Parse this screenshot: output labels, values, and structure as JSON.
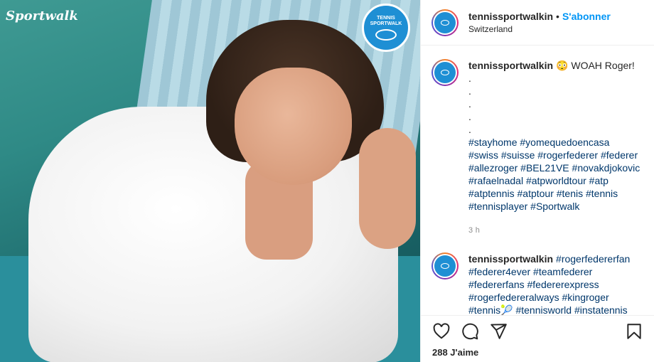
{
  "post": {
    "watermark": "Sportwalk",
    "badge_line1": "TENNIS",
    "badge_line2": "SPORTWALK"
  },
  "header": {
    "username": "tennissportwalkin",
    "separator": "•",
    "follow_label": "S'abonner",
    "location": "Switzerland"
  },
  "caption": {
    "username": "tennissportwalkin",
    "text": "😳 WOAH Roger!",
    "dots": [
      ".",
      ".",
      ".",
      ".",
      "."
    ],
    "hashtag_lines": [
      "#stayhome #yomequedoencasa",
      "#swiss #suisse #rogerfederer #federer",
      "#allezroger #BEL21VE #novakdjokovic",
      "#rafaelnadal #atpworldtour #atp",
      "#atptennis #atptour #tenis #tennis",
      "#tennisplayer #Sportwalk"
    ],
    "time": "3 h"
  },
  "comment2": {
    "username": "tennissportwalkin",
    "lines": [
      "#rogerfedererfan",
      "#federer4ever #teamfederer",
      "#federerfans #federerexpress",
      "#rogerfedereralways #kingroger",
      "#tennis🎾 #tennisworld #instatennis"
    ]
  },
  "actions": {
    "icons": [
      "heart-icon",
      "comment-icon",
      "share-icon",
      "bookmark-icon"
    ],
    "likes": "288 J'aime"
  }
}
